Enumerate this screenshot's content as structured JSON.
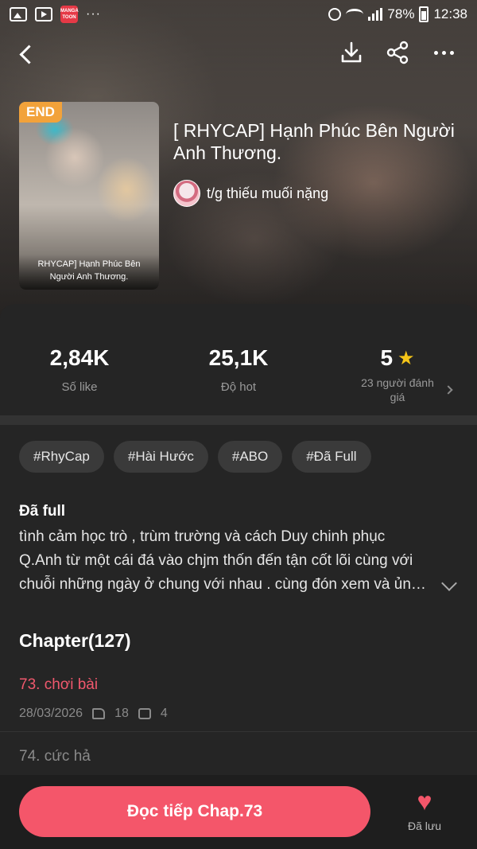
{
  "status_bar": {
    "battery": "78%",
    "time": "12:38",
    "manga_icon_text": "MANGA TOON",
    "overflow": "···"
  },
  "icons": {
    "back": "back-arrow-icon",
    "download": "download-icon",
    "share": "share-icon",
    "more": "more-icon",
    "star": "star-icon",
    "heart": "heart-icon"
  },
  "book": {
    "badge": "END",
    "cover_caption": "RHYCAP] Hạnh Phúc Bên Người Anh Thương.",
    "title": "[ RHYCAP] Hạnh Phúc Bên Người Anh Thương.",
    "author": "t/g thiếu muối nặng"
  },
  "stats": {
    "likes": {
      "value": "2,84K",
      "label": "Số like"
    },
    "hot": {
      "value": "25,1K",
      "label": "Độ hot"
    },
    "rating": {
      "value": "5",
      "label": "23 người đánh giá"
    }
  },
  "tags": [
    "#RhyCap",
    "#Hài Hước",
    "#ABO",
    "#Đã Full"
  ],
  "description": {
    "heading": "Đã full",
    "lines": [
      "tình cảm học trò , trùm trường và cách Duy chinh phục",
      "Q.Anh từ một cái đá vào chjm thốn đến tận cốt lõi cùng với",
      "chuỗi những ngày ở chung với nhau . cùng đón xem và ủng hộ"
    ]
  },
  "chapters": {
    "heading": "Chapter(127)",
    "items": [
      {
        "name": "73. chơi bài",
        "date": "28/03/2026",
        "likes": "18",
        "comments": "4"
      },
      {
        "name": "74. cức hả"
      }
    ]
  },
  "bottom": {
    "read_button": "Đọc tiếp Chap.73",
    "save_label": "Đã lưu"
  },
  "colors": {
    "accent": "#f4566a",
    "badge": "#f2a23a",
    "star": "#f5c518",
    "background": "#252525"
  }
}
